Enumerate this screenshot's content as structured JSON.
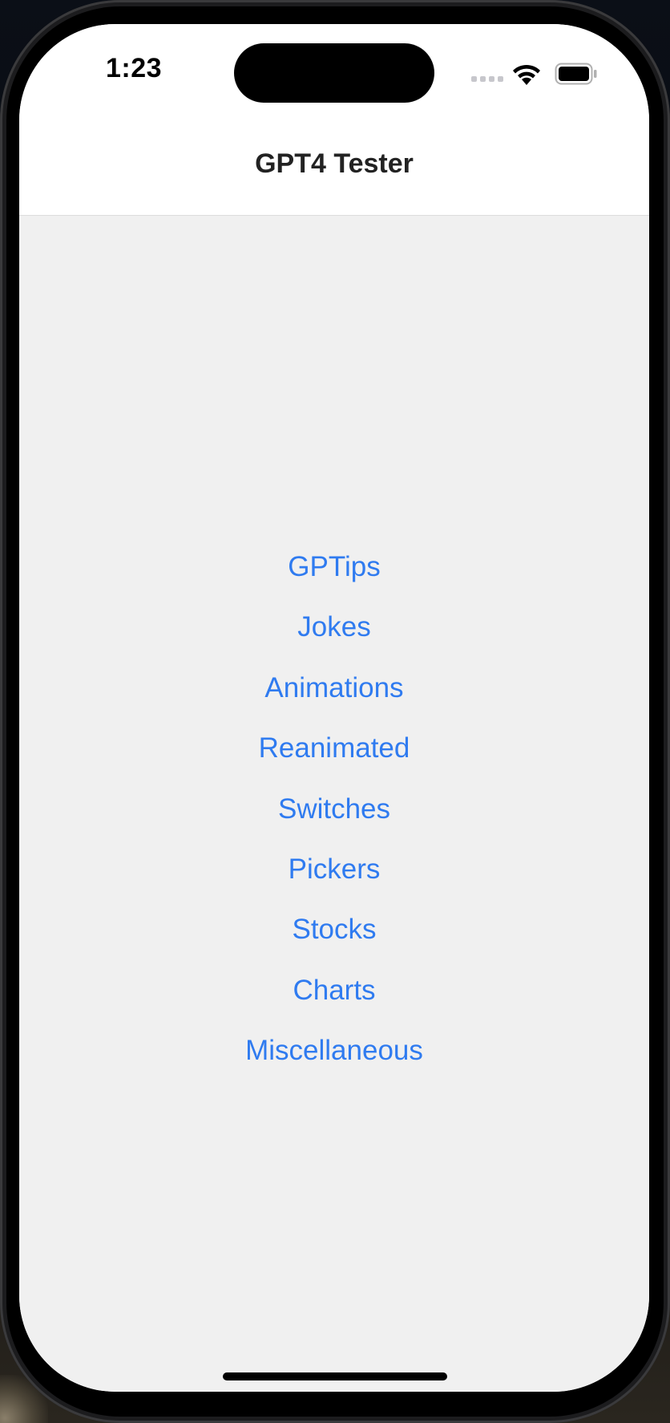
{
  "status_bar": {
    "time": "1:23",
    "icons": [
      "cellular-signal-icon",
      "wifi-icon",
      "battery-icon"
    ]
  },
  "nav_bar": {
    "title": "GPT4 Tester"
  },
  "menu": {
    "items": [
      {
        "label": "GPTips"
      },
      {
        "label": "Jokes"
      },
      {
        "label": "Animations"
      },
      {
        "label": "Reanimated"
      },
      {
        "label": "Switches"
      },
      {
        "label": "Pickers"
      },
      {
        "label": "Stocks"
      },
      {
        "label": "Charts"
      },
      {
        "label": "Miscellaneous"
      }
    ]
  },
  "colors": {
    "link": "#2f7bf0",
    "content_background": "#f0f0f0",
    "header_background": "#ffffff"
  }
}
